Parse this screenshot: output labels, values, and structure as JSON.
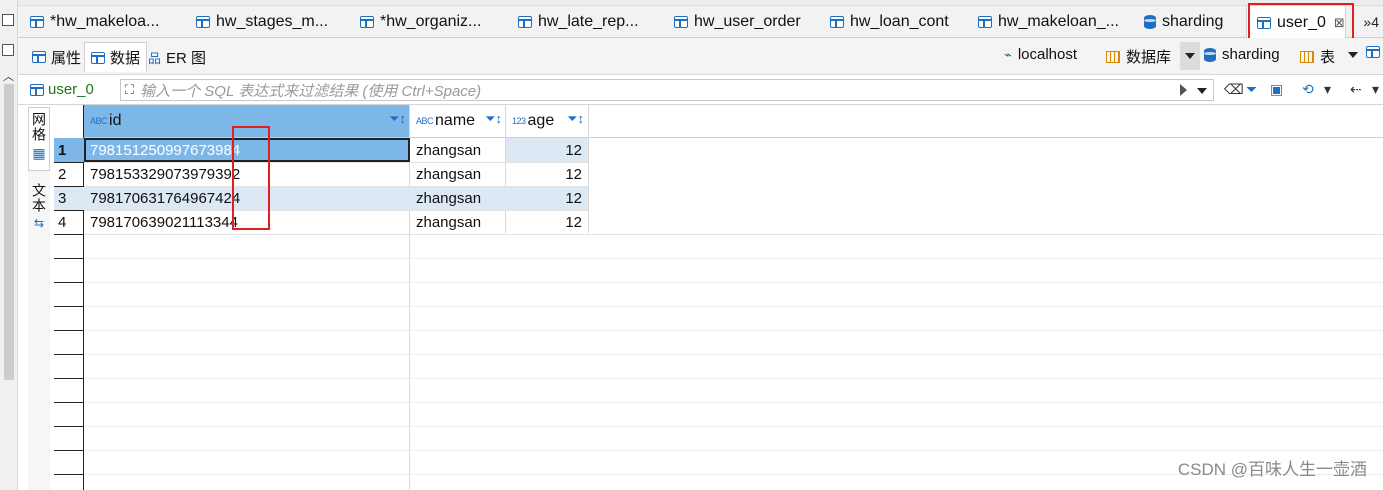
{
  "editor_tabs": [
    {
      "label": "*hw_makeloa...",
      "icon": "table-icon"
    },
    {
      "label": "hw_stages_m...",
      "icon": "table-icon"
    },
    {
      "label": "*hw_organiz...",
      "icon": "table-icon"
    },
    {
      "label": "hw_late_rep...",
      "icon": "table-icon"
    },
    {
      "label": "hw_user_order",
      "icon": "table-icon"
    },
    {
      "label": "hw_loan_cont",
      "icon": "table-icon"
    },
    {
      "label": "hw_makeloan_...",
      "icon": "table-icon"
    },
    {
      "label": "sharding",
      "icon": "database-icon"
    },
    {
      "label": "user_0",
      "icon": "table-icon",
      "active": true,
      "close": "⊠"
    }
  ],
  "tab_overflow": "»4",
  "view_tabs": [
    {
      "label": "属性"
    },
    {
      "label": "数据",
      "active": true
    },
    {
      "label": "ER 图"
    }
  ],
  "breadcrumb": {
    "host": "localhost",
    "database_label": "数据库",
    "schema": "sharding",
    "table_label": "表"
  },
  "filter": {
    "table_label": "user_0",
    "placeholder": "输入一个 SQL 表达式来过滤结果 (使用 Ctrl+Space)"
  },
  "side_tabs": [
    {
      "label": "网格",
      "active": true
    },
    {
      "label": "文本"
    }
  ],
  "grid": {
    "columns": [
      {
        "name": "id",
        "type_tag": "ABC"
      },
      {
        "name": "name",
        "type_tag": "ABC"
      },
      {
        "name": "age",
        "type_tag": "123"
      }
    ],
    "rows": [
      {
        "num": "1",
        "id": "798151250997673984",
        "name": "zhangsan",
        "age": "12"
      },
      {
        "num": "2",
        "id": "798153329073979392",
        "name": "zhangsan",
        "age": "12"
      },
      {
        "num": "3",
        "id": "798170631764967424",
        "name": "zhangsan",
        "age": "12"
      },
      {
        "num": "4",
        "id": "798170639021113344",
        "name": "zhangsan",
        "age": "12"
      }
    ]
  },
  "watermark": "CSDN @百味人生一壶酒",
  "colors": {
    "accent": "#1e6fc2",
    "header_selected": "#7db7e8",
    "row_alt": "#dde8f5",
    "annotation": "#e02020"
  }
}
